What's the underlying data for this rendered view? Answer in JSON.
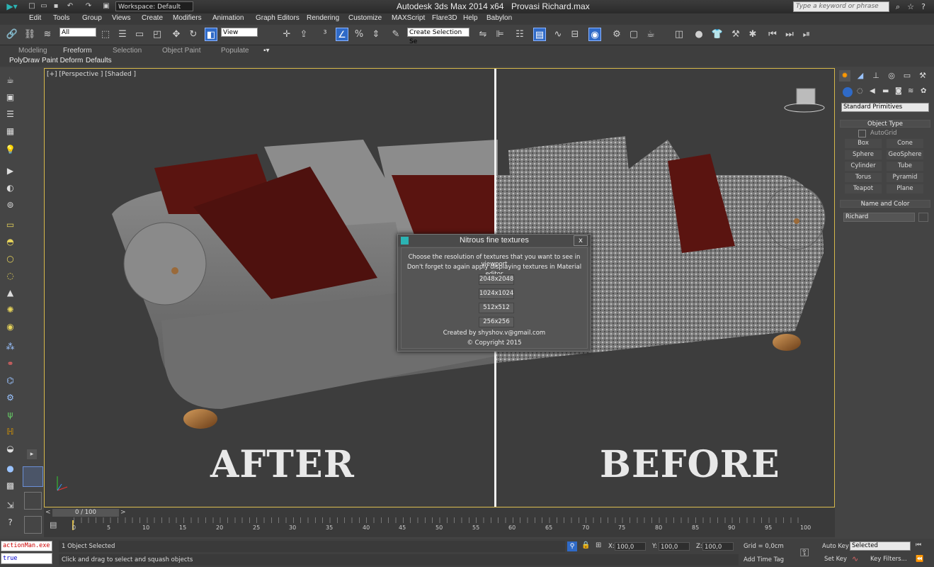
{
  "titlebar": {
    "workspace": "Workspace: Default",
    "app_title": "Autodesk 3ds Max  2014 x64",
    "file_title": "Provasi Richard.max",
    "search_placeholder": "Type a keyword or phrase"
  },
  "menu": [
    "Edit",
    "Tools",
    "Group",
    "Views",
    "Create",
    "Modifiers",
    "Animation",
    "Graph Editors",
    "Rendering",
    "Customize",
    "MAXScript",
    "Flare3D",
    "Help",
    "Babylon"
  ],
  "toolbar": {
    "selection_filter": "All",
    "ref_coord": "View",
    "named_selection": "Create Selection Se"
  },
  "ribbon": {
    "tabs": [
      "Modeling",
      "Freeform",
      "Selection",
      "Object Paint",
      "Populate"
    ],
    "active_tab": "Freeform",
    "subtabs": [
      "PolyDraw",
      "Paint Deform",
      "Defaults"
    ]
  },
  "viewport": {
    "label": "[+] [Perspective ] [Shaded ]",
    "left_caption": "AFTER",
    "right_caption": "BEFORE"
  },
  "dialog": {
    "title": "Nitrous fine textures",
    "line1": "Choose the resolution of textures that you want to see in viewport",
    "line2": "Don't forget to again apply displaying textures in Material editor",
    "buttons": [
      "2048x2048",
      "1024x1024",
      "512x512",
      "256x256"
    ],
    "credit": "Created by shyshov.v@gmail.com",
    "copyright": "© Copyright 2015",
    "close_label": "x"
  },
  "command_panel": {
    "category": "Standard Primitives",
    "object_type_header": "Object Type",
    "autogrid": "AutoGrid",
    "buttons": [
      "Box",
      "Cone",
      "Sphere",
      "GeoSphere",
      "Cylinder",
      "Tube",
      "Torus",
      "Pyramid",
      "Teapot",
      "Plane"
    ],
    "name_color_header": "Name and Color",
    "object_name": "Richard"
  },
  "timeline": {
    "frame_indicator": "0 / 100",
    "ticks": [
      "0",
      "5",
      "10",
      "15",
      "20",
      "25",
      "30",
      "35",
      "40",
      "45",
      "50",
      "55",
      "60",
      "65",
      "70",
      "75",
      "80",
      "85",
      "90",
      "95",
      "100"
    ]
  },
  "status": {
    "listener_top": "actionMan.exe",
    "listener_bottom": "true",
    "selected": "1 Object Selected",
    "prompt": "Click and drag to select and squash objects",
    "x_label": "X:",
    "x_value": "100,0",
    "y_label": "Y:",
    "y_value": "100,0",
    "z_label": "Z:",
    "z_value": "100,0",
    "grid": "Grid = 0,0cm",
    "add_time_tag": "Add Time Tag",
    "auto_key": "Auto Key",
    "set_key": "Set Key",
    "selected_combo": "Selected",
    "key_filters": "Key Filters..."
  },
  "colors": {
    "accent": "#2f6ac7",
    "viewport_border": "#d6b84a",
    "pillow_red": "#5a1410",
    "fabric_gray": "#8a8a8a"
  }
}
